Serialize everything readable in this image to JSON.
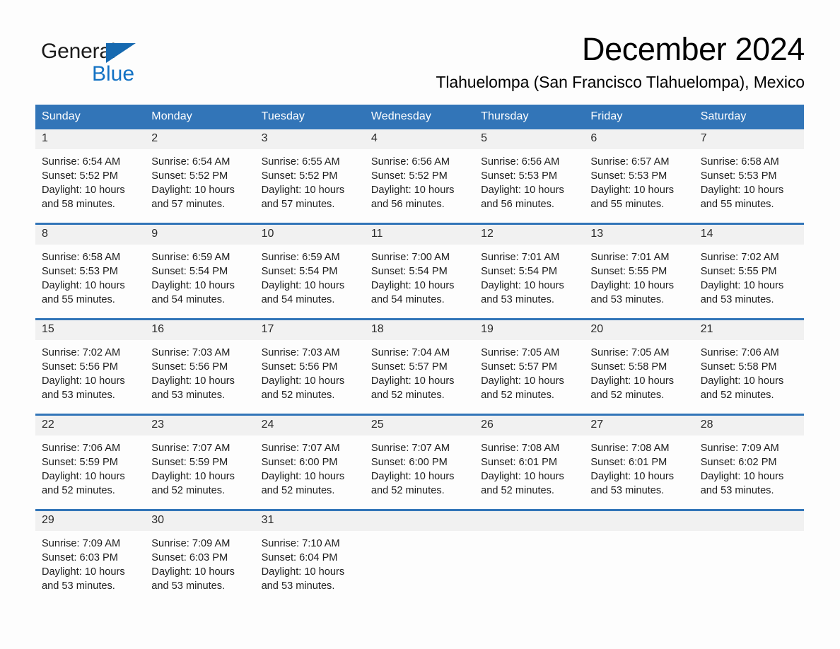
{
  "logo": {
    "general": "General",
    "blue": "Blue",
    "triangle_color": "#1669b0",
    "blue_color": "#1372c4"
  },
  "header": {
    "month_title": "December 2024",
    "location": "Tlahuelompa (San Francisco Tlahuelompa), Mexico"
  },
  "theme": {
    "header_blue": "#3275b8",
    "daynum_gray": "#f1f1f1",
    "page_background": "#fdfdfd"
  },
  "weekday_headers": [
    "Sunday",
    "Monday",
    "Tuesday",
    "Wednesday",
    "Thursday",
    "Friday",
    "Saturday"
  ],
  "weeks": [
    [
      {
        "day": "1",
        "sunrise": "Sunrise: 6:54 AM",
        "sunset": "Sunset: 5:52 PM",
        "daylight_line1": "Daylight: 10 hours",
        "daylight_line2": "and 58 minutes."
      },
      {
        "day": "2",
        "sunrise": "Sunrise: 6:54 AM",
        "sunset": "Sunset: 5:52 PM",
        "daylight_line1": "Daylight: 10 hours",
        "daylight_line2": "and 57 minutes."
      },
      {
        "day": "3",
        "sunrise": "Sunrise: 6:55 AM",
        "sunset": "Sunset: 5:52 PM",
        "daylight_line1": "Daylight: 10 hours",
        "daylight_line2": "and 57 minutes."
      },
      {
        "day": "4",
        "sunrise": "Sunrise: 6:56 AM",
        "sunset": "Sunset: 5:52 PM",
        "daylight_line1": "Daylight: 10 hours",
        "daylight_line2": "and 56 minutes."
      },
      {
        "day": "5",
        "sunrise": "Sunrise: 6:56 AM",
        "sunset": "Sunset: 5:53 PM",
        "daylight_line1": "Daylight: 10 hours",
        "daylight_line2": "and 56 minutes."
      },
      {
        "day": "6",
        "sunrise": "Sunrise: 6:57 AM",
        "sunset": "Sunset: 5:53 PM",
        "daylight_line1": "Daylight: 10 hours",
        "daylight_line2": "and 55 minutes."
      },
      {
        "day": "7",
        "sunrise": "Sunrise: 6:58 AM",
        "sunset": "Sunset: 5:53 PM",
        "daylight_line1": "Daylight: 10 hours",
        "daylight_line2": "and 55 minutes."
      }
    ],
    [
      {
        "day": "8",
        "sunrise": "Sunrise: 6:58 AM",
        "sunset": "Sunset: 5:53 PM",
        "daylight_line1": "Daylight: 10 hours",
        "daylight_line2": "and 55 minutes."
      },
      {
        "day": "9",
        "sunrise": "Sunrise: 6:59 AM",
        "sunset": "Sunset: 5:54 PM",
        "daylight_line1": "Daylight: 10 hours",
        "daylight_line2": "and 54 minutes."
      },
      {
        "day": "10",
        "sunrise": "Sunrise: 6:59 AM",
        "sunset": "Sunset: 5:54 PM",
        "daylight_line1": "Daylight: 10 hours",
        "daylight_line2": "and 54 minutes."
      },
      {
        "day": "11",
        "sunrise": "Sunrise: 7:00 AM",
        "sunset": "Sunset: 5:54 PM",
        "daylight_line1": "Daylight: 10 hours",
        "daylight_line2": "and 54 minutes."
      },
      {
        "day": "12",
        "sunrise": "Sunrise: 7:01 AM",
        "sunset": "Sunset: 5:54 PM",
        "daylight_line1": "Daylight: 10 hours",
        "daylight_line2": "and 53 minutes."
      },
      {
        "day": "13",
        "sunrise": "Sunrise: 7:01 AM",
        "sunset": "Sunset: 5:55 PM",
        "daylight_line1": "Daylight: 10 hours",
        "daylight_line2": "and 53 minutes."
      },
      {
        "day": "14",
        "sunrise": "Sunrise: 7:02 AM",
        "sunset": "Sunset: 5:55 PM",
        "daylight_line1": "Daylight: 10 hours",
        "daylight_line2": "and 53 minutes."
      }
    ],
    [
      {
        "day": "15",
        "sunrise": "Sunrise: 7:02 AM",
        "sunset": "Sunset: 5:56 PM",
        "daylight_line1": "Daylight: 10 hours",
        "daylight_line2": "and 53 minutes."
      },
      {
        "day": "16",
        "sunrise": "Sunrise: 7:03 AM",
        "sunset": "Sunset: 5:56 PM",
        "daylight_line1": "Daylight: 10 hours",
        "daylight_line2": "and 53 minutes."
      },
      {
        "day": "17",
        "sunrise": "Sunrise: 7:03 AM",
        "sunset": "Sunset: 5:56 PM",
        "daylight_line1": "Daylight: 10 hours",
        "daylight_line2": "and 52 minutes."
      },
      {
        "day": "18",
        "sunrise": "Sunrise: 7:04 AM",
        "sunset": "Sunset: 5:57 PM",
        "daylight_line1": "Daylight: 10 hours",
        "daylight_line2": "and 52 minutes."
      },
      {
        "day": "19",
        "sunrise": "Sunrise: 7:05 AM",
        "sunset": "Sunset: 5:57 PM",
        "daylight_line1": "Daylight: 10 hours",
        "daylight_line2": "and 52 minutes."
      },
      {
        "day": "20",
        "sunrise": "Sunrise: 7:05 AM",
        "sunset": "Sunset: 5:58 PM",
        "daylight_line1": "Daylight: 10 hours",
        "daylight_line2": "and 52 minutes."
      },
      {
        "day": "21",
        "sunrise": "Sunrise: 7:06 AM",
        "sunset": "Sunset: 5:58 PM",
        "daylight_line1": "Daylight: 10 hours",
        "daylight_line2": "and 52 minutes."
      }
    ],
    [
      {
        "day": "22",
        "sunrise": "Sunrise: 7:06 AM",
        "sunset": "Sunset: 5:59 PM",
        "daylight_line1": "Daylight: 10 hours",
        "daylight_line2": "and 52 minutes."
      },
      {
        "day": "23",
        "sunrise": "Sunrise: 7:07 AM",
        "sunset": "Sunset: 5:59 PM",
        "daylight_line1": "Daylight: 10 hours",
        "daylight_line2": "and 52 minutes."
      },
      {
        "day": "24",
        "sunrise": "Sunrise: 7:07 AM",
        "sunset": "Sunset: 6:00 PM",
        "daylight_line1": "Daylight: 10 hours",
        "daylight_line2": "and 52 minutes."
      },
      {
        "day": "25",
        "sunrise": "Sunrise: 7:07 AM",
        "sunset": "Sunset: 6:00 PM",
        "daylight_line1": "Daylight: 10 hours",
        "daylight_line2": "and 52 minutes."
      },
      {
        "day": "26",
        "sunrise": "Sunrise: 7:08 AM",
        "sunset": "Sunset: 6:01 PM",
        "daylight_line1": "Daylight: 10 hours",
        "daylight_line2": "and 52 minutes."
      },
      {
        "day": "27",
        "sunrise": "Sunrise: 7:08 AM",
        "sunset": "Sunset: 6:01 PM",
        "daylight_line1": "Daylight: 10 hours",
        "daylight_line2": "and 53 minutes."
      },
      {
        "day": "28",
        "sunrise": "Sunrise: 7:09 AM",
        "sunset": "Sunset: 6:02 PM",
        "daylight_line1": "Daylight: 10 hours",
        "daylight_line2": "and 53 minutes."
      }
    ],
    [
      {
        "day": "29",
        "sunrise": "Sunrise: 7:09 AM",
        "sunset": "Sunset: 6:03 PM",
        "daylight_line1": "Daylight: 10 hours",
        "daylight_line2": "and 53 minutes."
      },
      {
        "day": "30",
        "sunrise": "Sunrise: 7:09 AM",
        "sunset": "Sunset: 6:03 PM",
        "daylight_line1": "Daylight: 10 hours",
        "daylight_line2": "and 53 minutes."
      },
      {
        "day": "31",
        "sunrise": "Sunrise: 7:10 AM",
        "sunset": "Sunset: 6:04 PM",
        "daylight_line1": "Daylight: 10 hours",
        "daylight_line2": "and 53 minutes."
      },
      {
        "day": "",
        "sunrise": "",
        "sunset": "",
        "daylight_line1": "",
        "daylight_line2": ""
      },
      {
        "day": "",
        "sunrise": "",
        "sunset": "",
        "daylight_line1": "",
        "daylight_line2": ""
      },
      {
        "day": "",
        "sunrise": "",
        "sunset": "",
        "daylight_line1": "",
        "daylight_line2": ""
      },
      {
        "day": "",
        "sunrise": "",
        "sunset": "",
        "daylight_line1": "",
        "daylight_line2": ""
      }
    ]
  ]
}
